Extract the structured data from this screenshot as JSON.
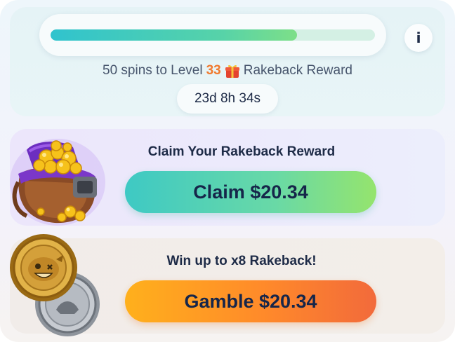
{
  "progress": {
    "fill_fraction": 0.76,
    "spins_text_before": "50 spins to Level",
    "level_number": "33",
    "gift_icon": "gift-icon",
    "spins_text_after": "Rakeback Reward",
    "timer": "23d 8h 34s",
    "info_label": "i"
  },
  "claim": {
    "heading": "Claim Your Rakeback Reward",
    "button_label": "Claim $20.34",
    "art_icon": "treasure-bag-icon"
  },
  "gamble": {
    "heading": "Win up to x8 Rakeback!",
    "button_label": "Gamble $20.34",
    "art_icon": "coins-icon"
  },
  "colors": {
    "level_accent": "#f07a2f",
    "claim_gradient_start": "#3ec9c4",
    "claim_gradient_end": "#95e46d",
    "gamble_gradient_start": "#ffb01c",
    "gamble_gradient_end": "#f26a3b",
    "text_dark": "#1e2b47"
  }
}
